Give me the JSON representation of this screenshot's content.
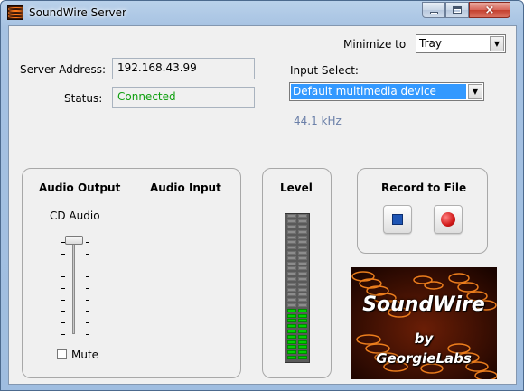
{
  "window": {
    "title": "SoundWire Server",
    "close_glyph": "×"
  },
  "minimize": {
    "label": "Minimize to",
    "value": "Tray"
  },
  "server": {
    "address_label": "Server Address:",
    "address": "192.168.43.99",
    "status_label": "Status:",
    "status": "Connected",
    "status_color": "#10a010"
  },
  "input": {
    "label": "Input Select:",
    "value": "Default multimedia device",
    "sample_rate": "44.1 kHz",
    "sample_rate_color": "#6a7fa8"
  },
  "audio": {
    "output_label": "Audio Output",
    "input_label": "Audio Input",
    "device": "CD Audio",
    "volume_level": 1.0,
    "mute_label": "Mute",
    "mute_checked": false
  },
  "level": {
    "label": "Level",
    "active_segments": 10,
    "total_segments": 28,
    "active_color": "#00d000"
  },
  "record": {
    "label": "Record to File",
    "stop_icon": "stop-icon",
    "record_icon": "record-icon"
  },
  "logo": {
    "title": "SoundWire",
    "by": "by",
    "company": "GeorgieLabs"
  },
  "colors": {
    "selection": "#3399ff",
    "stop": "#1e55b4",
    "record": "#d01818"
  }
}
